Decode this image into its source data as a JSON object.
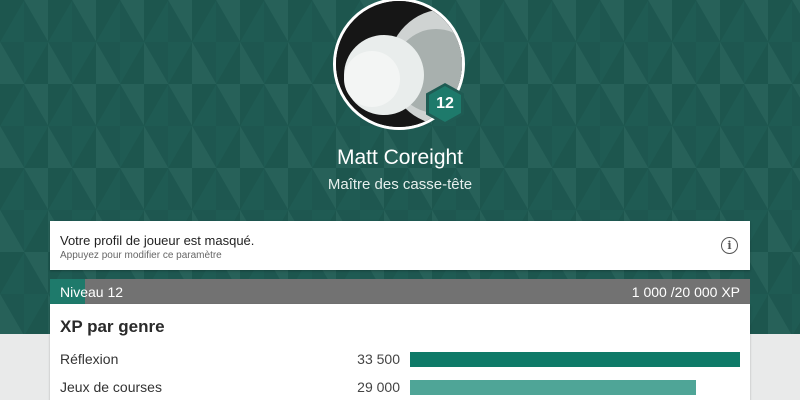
{
  "profile": {
    "name": "Matt Coreight",
    "title": "Maître des casse-tête",
    "level_badge": "12",
    "accent_color": "#1e7a6b"
  },
  "privacy": {
    "title": "Votre profil de joueur est masqué.",
    "subtitle": "Appuyez pour modifier ce paramètre",
    "icon": "info-icon"
  },
  "level": {
    "label": "Niveau 12",
    "xp_text": "1 000 /20 000 XP",
    "progress": 0.05
  },
  "genres": {
    "title": "XP par genre",
    "max_value": 33500,
    "items": [
      {
        "name": "Réflexion",
        "value_text": "33 500",
        "value": 33500,
        "color": "#0e7a68"
      },
      {
        "name": "Jeux de courses",
        "value_text": "29 000",
        "value": 29000,
        "color": "#4fa597"
      }
    ]
  }
}
